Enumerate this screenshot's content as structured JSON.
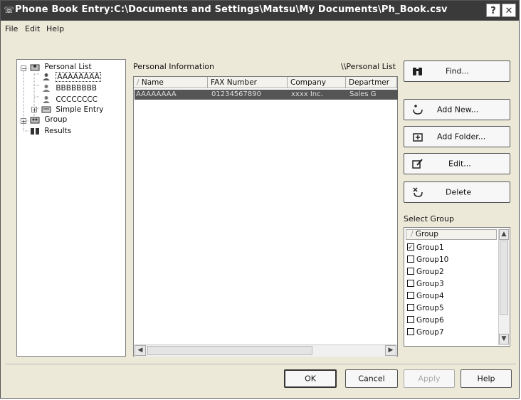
{
  "window": {
    "title": "Phone Book Entry:C:\\Documents and Settings\\Matsu\\My Documents\\Ph_Book.csv",
    "help_label": "?",
    "close_label": "✕"
  },
  "menu": [
    "File",
    "Edit",
    "Help"
  ],
  "tree": {
    "personal_list": "Personal List",
    "entries": [
      "AAAAAAAA",
      "BBBBBBBB",
      "CCCCCCCC"
    ],
    "simple_entry": "Simple Entry",
    "group": "Group",
    "results": "Results"
  },
  "personal_info": {
    "label": "Personal Information",
    "path": "\\\\Personal List",
    "columns": [
      "Name",
      "FAX Number",
      "Company",
      "Departmer"
    ],
    "rows": [
      [
        "AAAAAAAA",
        "01234567890",
        "xxxx Inc.",
        "Sales G"
      ]
    ]
  },
  "actions": {
    "find": "Find...",
    "add_new": "Add New...",
    "add_folder": "Add Folder...",
    "edit": "Edit...",
    "delete": "Delete"
  },
  "select_group": {
    "label": "Select Group",
    "column": "Group",
    "items": [
      {
        "name": "Group1",
        "checked": true
      },
      {
        "name": "Group10",
        "checked": false
      },
      {
        "name": "Group2",
        "checked": false
      },
      {
        "name": "Group3",
        "checked": false
      },
      {
        "name": "Group4",
        "checked": false
      },
      {
        "name": "Group5",
        "checked": false
      },
      {
        "name": "Group6",
        "checked": false
      },
      {
        "name": "Group7",
        "checked": false
      }
    ]
  },
  "footer": {
    "ok": "OK",
    "cancel": "Cancel",
    "apply": "Apply",
    "help": "Help"
  }
}
